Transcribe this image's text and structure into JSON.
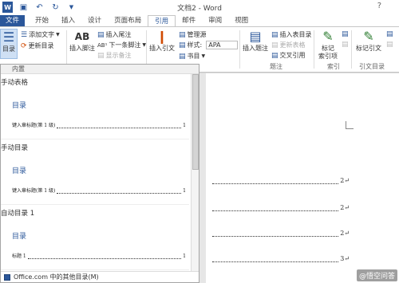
{
  "window": {
    "title": "文档2 - Word",
    "help_icon": "?"
  },
  "quick_access": {
    "icons": [
      "word-app-icon",
      "save-icon",
      "undo-icon",
      "redo-icon",
      "customize-icon"
    ]
  },
  "tabs": {
    "file": "文件",
    "items": [
      "开始",
      "插入",
      "设计",
      "页面布局",
      "引用",
      "邮件",
      "审阅",
      "视图"
    ],
    "active": "引用"
  },
  "ribbon": {
    "toc": {
      "big_label": "目录",
      "add_text": "添加文字",
      "update_toc": "更新目录"
    },
    "footnotes": {
      "insert_footnote": "插入脚注",
      "insert_endnote": "插入尾注",
      "next_footnote": "下一条脚注",
      "show_notes": "显示备注",
      "ab_icon": "AB"
    },
    "citations": {
      "insert_citation": "插入引文",
      "manage_sources": "管理源",
      "style_label": "样式:",
      "style_value": "APA",
      "bibliography": "书目"
    },
    "captions": {
      "insert_caption": "插入题注",
      "insert_table_of_figures": "插入表目录",
      "update_table": "更新表格",
      "cross_reference": "交叉引用",
      "group_label": "题注"
    },
    "index": {
      "mark_entry": "标记",
      "mark_entry_2": "索引项",
      "group_label": "索引"
    },
    "citation_table": {
      "mark_citation": "标记引文",
      "group_label": "引文目录"
    }
  },
  "gallery": {
    "header": "内置",
    "items": [
      {
        "title": "手动表格",
        "heading": "目录",
        "entry": "键入章标题(第 1 级)",
        "page": "1"
      },
      {
        "title": "手动目录",
        "heading": "目录",
        "entry": "键入章标题(第 1 级)",
        "page": "1"
      },
      {
        "title": "自动目录 1",
        "heading": "目录",
        "entry": "标题 1",
        "page": "1"
      }
    ],
    "footer": "Office.com 中的其他目录(M)"
  },
  "document": {
    "page_numbers": [
      "2↵",
      "2↵",
      "2↵",
      "3↵"
    ]
  },
  "watermark": "@悟空问答"
}
